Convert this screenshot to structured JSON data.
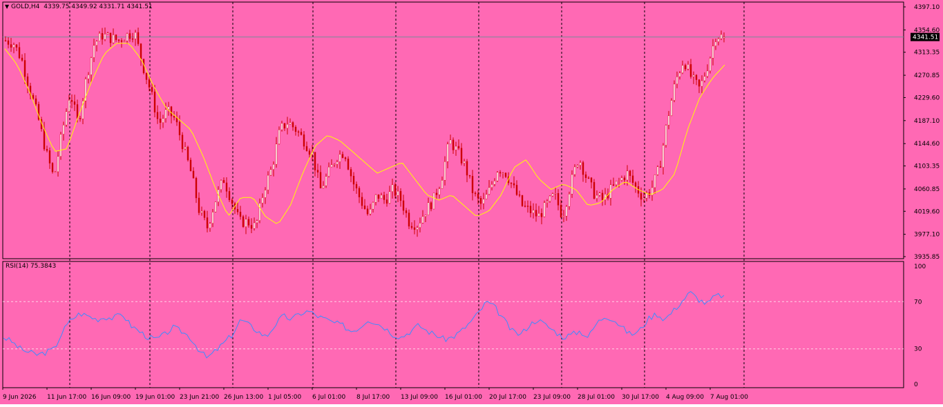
{
  "colors": {
    "background": "#ff69b4",
    "bull_candle": "#ffffff",
    "bear_candle": "#cc0000",
    "ma_line": "#ffff00",
    "rsi_line": "#3c8cff",
    "bid_line": "#7a8a99",
    "grid": "#000000",
    "text": "#000000"
  },
  "header": {
    "symbol_icon": "triangle-down-icon",
    "symbol": "GOLD,H4",
    "ohlc": "4339.75 4349.92 4331.71 4341.51"
  },
  "price_axis": {
    "ticks": [
      "4397.10",
      "4354.60",
      "4313.35",
      "4270.85",
      "4229.60",
      "4187.10",
      "4144.60",
      "4103.35",
      "4060.85",
      "4019.60",
      "3977.10",
      "3935.85"
    ],
    "current_price_label": "4341.51"
  },
  "rsi_panel": {
    "label": "RSI(14) 75.3843",
    "ticks": [
      "100",
      "70",
      "30",
      "0"
    ]
  },
  "time_axis": {
    "labels": [
      "9 Jun 2026",
      "11 Jun 17:00",
      "16 Jun 09:00",
      "19 Jun 01:00",
      "23 Jun 21:00",
      "26 Jun 13:00",
      "1 Jul 05:00",
      "6 Jul 01:00",
      "8 Jul 17:00",
      "13 Jul 09:00",
      "16 Jul 01:00",
      "20 Jul 17:00",
      "23 Jul 09:00",
      "28 Jul 01:00",
      "30 Jul 17:00",
      "4 Aug 09:00",
      "7 Aug 01:00"
    ]
  },
  "chart_data": {
    "type": "candlestick",
    "symbol": "GOLD",
    "timeframe": "H4",
    "last": {
      "open": 4339.75,
      "high": 4349.92,
      "low": 4331.71,
      "close": 4341.51
    },
    "ylim": [
      3935.85,
      4397.1
    ],
    "rsi_period": 14,
    "rsi_last": 75.3843,
    "rsi_ylim": [
      0,
      100
    ],
    "rsi_levels": [
      70,
      30
    ],
    "close_path": [
      4335,
      4330,
      4300,
      4245,
      4195,
      4130,
      4080,
      4165,
      4240,
      4180,
      4265,
      4330,
      4345,
      4340,
      4335,
      4345,
      4350,
      4290,
      4240,
      4180,
      4205,
      4190,
      4140,
      4090,
      4020,
      3990,
      4040,
      4080,
      4040,
      4000,
      4000,
      3990,
      4060,
      4100,
      4170,
      4185,
      4170,
      4150,
      4125,
      4060,
      4090,
      4120,
      4130,
      4075,
      4040,
      4010,
      4050,
      4040,
      4060,
      4040,
      4000,
      3995,
      4020,
      4040,
      4080,
      4150,
      4130,
      4100,
      4050,
      4030,
      4060,
      4100,
      4090,
      4060,
      4030,
      4020,
      4010,
      4030,
      4050,
      4010,
      4070,
      4120,
      4080,
      4050,
      4040,
      4060,
      4075,
      4090,
      4065,
      4045,
      4060,
      4100,
      4190,
      4260,
      4300,
      4265,
      4245,
      4290,
      4345,
      4341.51
    ],
    "ma_path": [
      4320,
      4290,
      4240,
      4180,
      4130,
      4135,
      4200,
      4260,
      4310,
      4330,
      4330,
      4300,
      4250,
      4210,
      4190,
      4170,
      4120,
      4060,
      4010,
      4045,
      4045,
      4010,
      3995,
      4030,
      4090,
      4140,
      4160,
      4150,
      4130,
      4110,
      4090,
      4100,
      4110,
      4080,
      4050,
      4040,
      4050,
      4030,
      4010,
      4020,
      4050,
      4100,
      4115,
      4080,
      4060,
      4070,
      4060,
      4030,
      4035,
      4060,
      4075,
      4060,
      4050,
      4060,
      4090,
      4170,
      4230,
      4265,
      4290
    ],
    "rsi_path": [
      40,
      36,
      30,
      27,
      25,
      27,
      30,
      45,
      55,
      60,
      58,
      55,
      57,
      56,
      60,
      50,
      45,
      40,
      38,
      42,
      48,
      45,
      40,
      30,
      22,
      28,
      35,
      42,
      55,
      50,
      45,
      40,
      50,
      58,
      55,
      60,
      62,
      58,
      55,
      52,
      50,
      45,
      48,
      55,
      52,
      48,
      42,
      40,
      45,
      50,
      45,
      42,
      38,
      40,
      45,
      52,
      60,
      70,
      65,
      55,
      45,
      42,
      50,
      55,
      50,
      45,
      40,
      42,
      45,
      40,
      52,
      58,
      55,
      48,
      42,
      45,
      55,
      60,
      55,
      62,
      70,
      78,
      72,
      68,
      75,
      75.3843
    ]
  }
}
